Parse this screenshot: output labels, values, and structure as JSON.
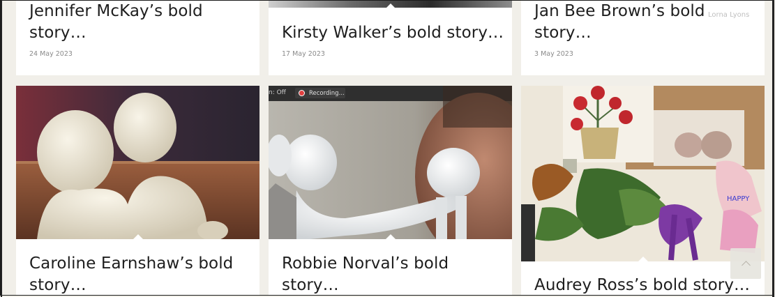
{
  "row1": [
    {
      "title_line1": "Jennifer McKay’s bold",
      "title_line2": "story…",
      "date": "24 May 2023"
    },
    {
      "title_line1": "Kirsty Walker’s bold story…",
      "title_line2": "",
      "date": "17 May 2023"
    },
    {
      "title_line1": "Jan Bee Brown’s bold",
      "title_line2": "story…",
      "date": "3 May 2023"
    }
  ],
  "row2": [
    {
      "title_line1": "Caroline Earnshaw’s bold",
      "title_line2": "story…",
      "image": "clay-figures-embracing"
    },
    {
      "title_line1": "Robbie Norval’s bold",
      "title_line2": "story…",
      "image": "clay-figures-video-call"
    },
    {
      "title_line1": "Audrey Ross’s bold story…",
      "title_line2": "",
      "image": "craft-collage-flowers"
    }
  ],
  "video_overlay": {
    "mic_status": "n: Off",
    "recording": "Recording…"
  },
  "top_right_overlay": "Lorna Lyons",
  "icons": {
    "back_to_top": "chevron-up-icon",
    "recording": "record-dot-icon"
  }
}
